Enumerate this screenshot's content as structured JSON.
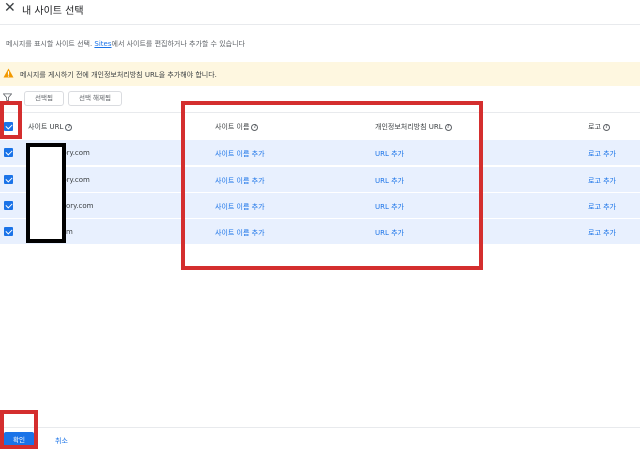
{
  "header": {
    "title": "내 사이트 선택",
    "close_icon": "close-icon"
  },
  "description": {
    "before": "메시지를 표시할 사이트 선택. ",
    "link": "Sites",
    "after": "에서 사이트를 편집하거나 추가할 수 있습니다"
  },
  "warning": {
    "icon": "warning-icon",
    "text": "메시지를 게시하기 전에 개인정보처리방침 URL을 추가해야 합니다."
  },
  "toolbar": {
    "filter_icon": "filter-icon",
    "select_label": "선택됨",
    "deselect_label": "선택 해제됨"
  },
  "table": {
    "headers": {
      "site_url": "사이트 URL",
      "site_name": "사이트 이름",
      "privacy_url": "개인정보처리방침 URL",
      "logo": "로고"
    },
    "rows": [
      {
        "url": "story.com",
        "name_action": "사이트 이름 추가",
        "url_action": "URL 추가",
        "logo_action": "로고 추가",
        "checked": true
      },
      {
        "url": "story.com",
        "name_action": "사이트 이름 추가",
        "url_action": "URL 추가",
        "logo_action": "로고 추가",
        "checked": true
      },
      {
        "url": "ory.com",
        "name_action": "사이트 이름 추가",
        "url_action": "URL 추가",
        "logo_action": "로고 추가",
        "checked": true
      },
      {
        "url": "m",
        "name_action": "사이트 이름 추가",
        "url_action": "URL 추가",
        "logo_action": "로고 추가",
        "checked": true
      }
    ]
  },
  "footer": {
    "confirm_label": "확인",
    "cancel_label": "취소"
  },
  "colors": {
    "accent": "#1a73e8",
    "row_selected": "#e8f0fe",
    "warning_bg": "#fef7e0",
    "warning_icon": "#f29900",
    "annotation": "#d42e2e",
    "redaction": "#000000"
  }
}
